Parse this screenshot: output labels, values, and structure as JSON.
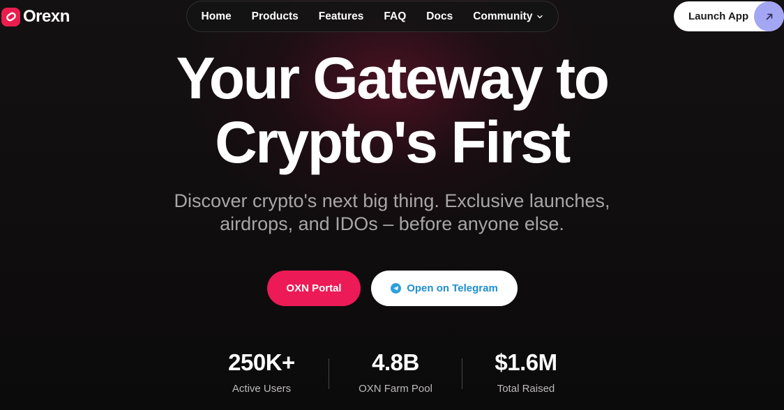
{
  "brand": {
    "name": "Orexn",
    "accent": "#ea1d4e"
  },
  "nav": {
    "items": [
      {
        "label": "Home"
      },
      {
        "label": "Products"
      },
      {
        "label": "Features"
      },
      {
        "label": "FAQ"
      },
      {
        "label": "Docs"
      },
      {
        "label": "Community"
      }
    ]
  },
  "header": {
    "launch_label": "Launch App",
    "launch_icon": "arrow-up-right-icon",
    "launch_icon_color": "#a3a6f2"
  },
  "hero": {
    "title_line1": "Your Gateway to",
    "title_line2": "Crypto's First",
    "subtitle_line1": "Discover crypto's next big thing. Exclusive launches,",
    "subtitle_line2": "airdrops, and IDOs – before anyone else."
  },
  "cta": {
    "primary_label": "OXN Portal",
    "primary_color": "#ec1a56",
    "secondary_label": "Open on Telegram",
    "secondary_icon": "telegram-icon",
    "secondary_color": "#1e8fd0"
  },
  "stats": [
    {
      "value": "250K+",
      "label": "Active Users"
    },
    {
      "value": "4.8B",
      "label": "OXN Farm Pool"
    },
    {
      "value": "$1.6M",
      "label": "Total Raised"
    }
  ]
}
